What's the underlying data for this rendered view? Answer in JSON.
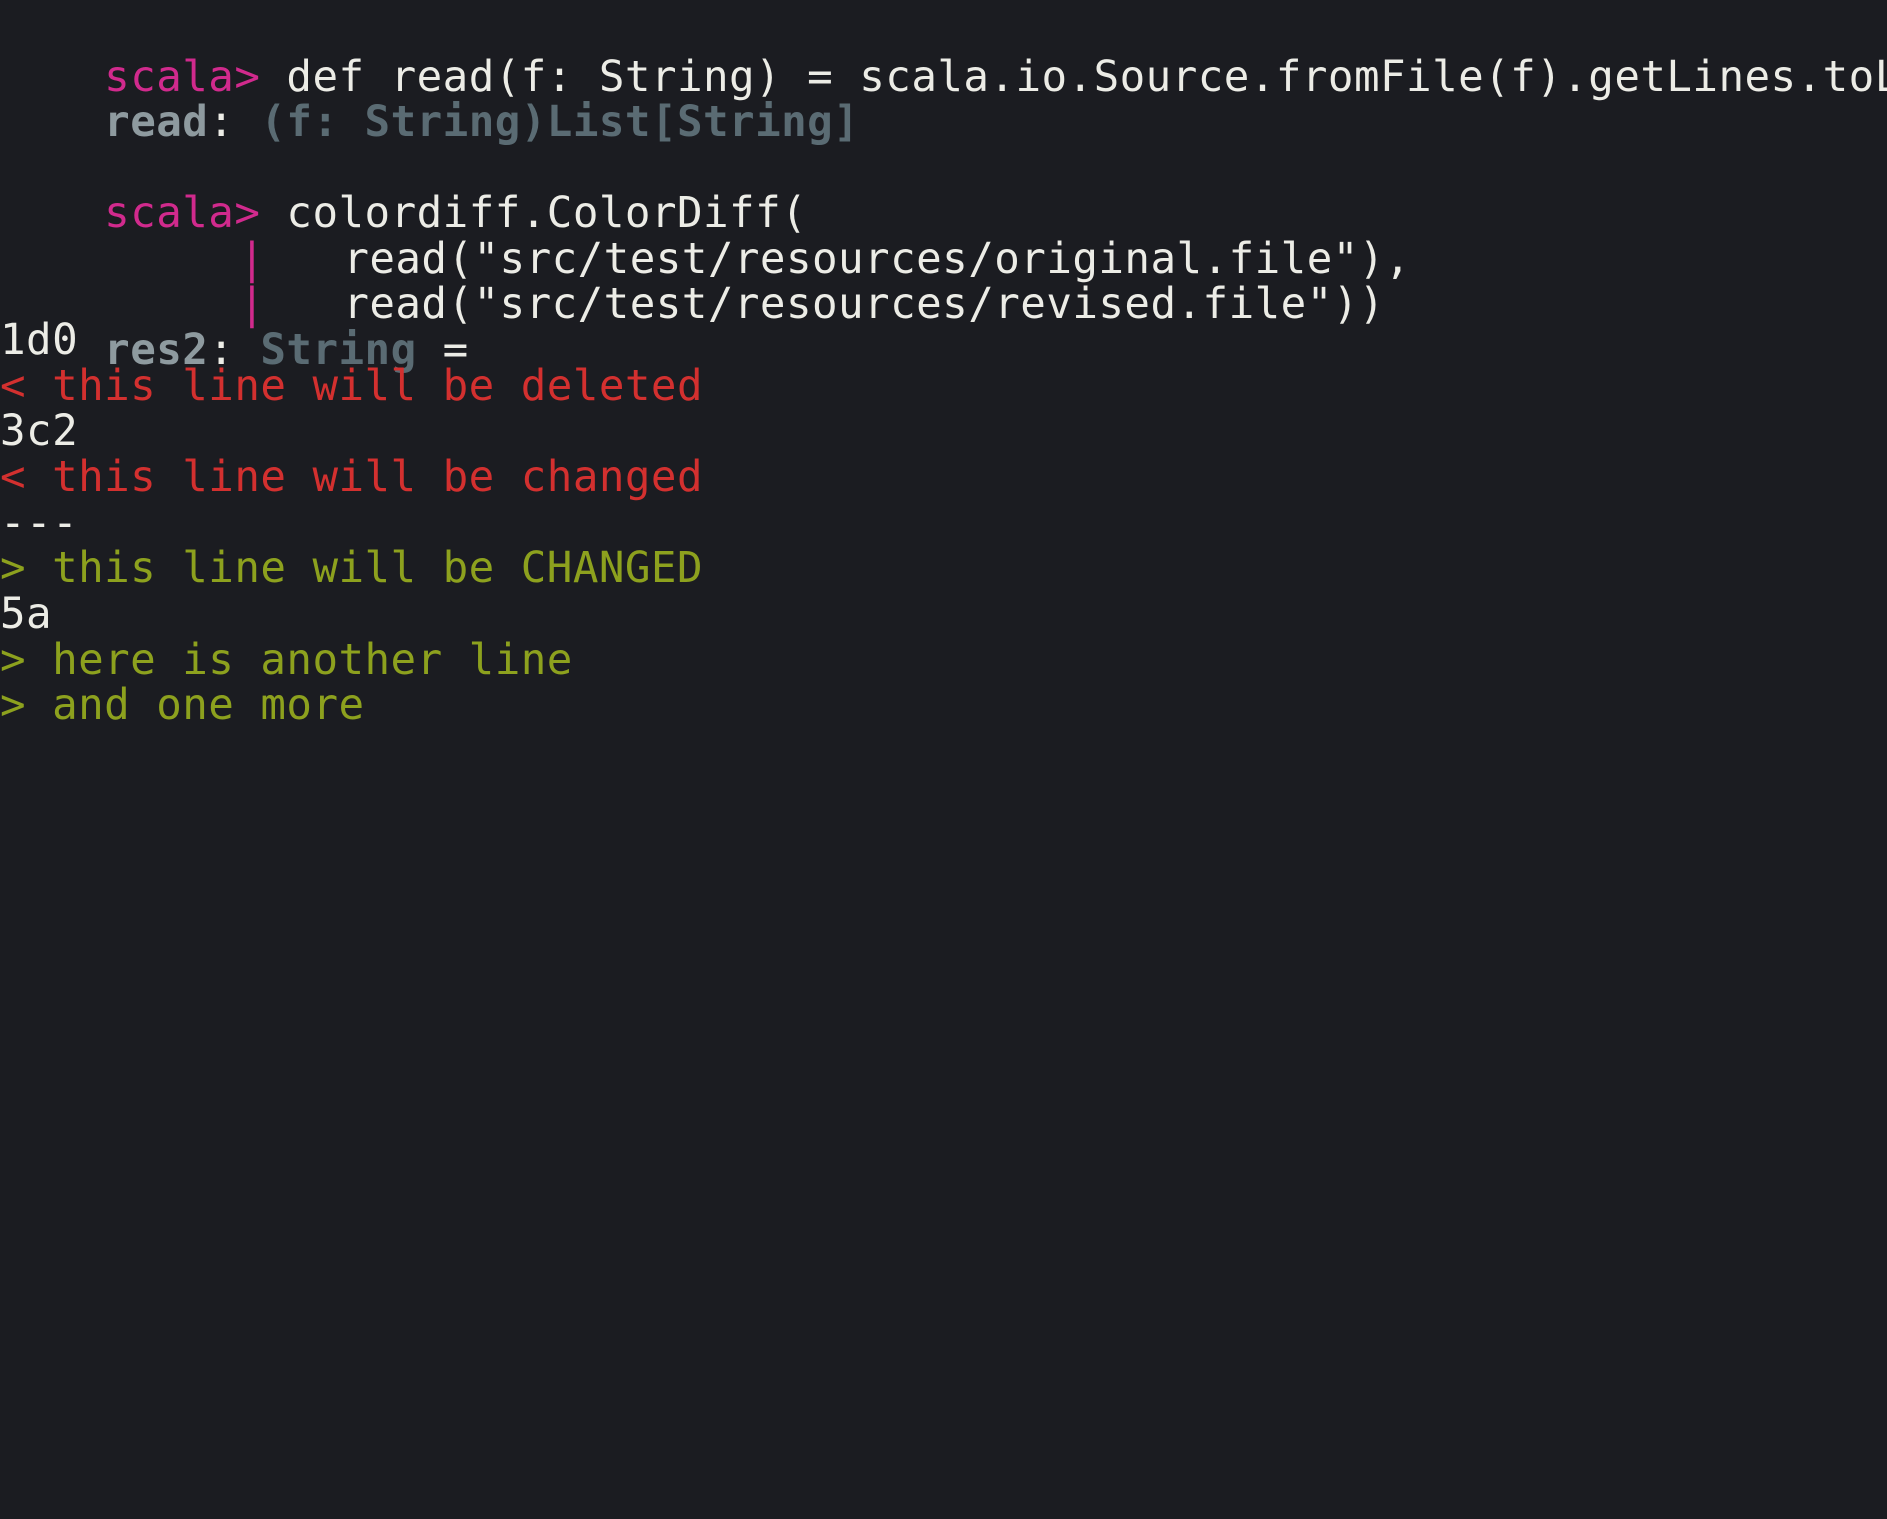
{
  "terminal": {
    "prompt": "scala>",
    "lines": {
      "l1_code": " def read(f: String) = scala.io.Source.fromFile(f).getLines.toList",
      "l2_name": "read",
      "l2_colon": ": ",
      "l2_type": "(f: String)List[String]",
      "l4_code": " colordiff.ColorDiff(",
      "l5_pipe": "|",
      "l5_code": "   read(\"src/test/resources/original.file\"),",
      "l6_pipe": "|",
      "l6_code": "   read(\"src/test/resources/revised.file\"))",
      "l7_name": "res2",
      "l7_colon": ": ",
      "l7_type": "String",
      "l7_eq": " =",
      "l8": "1d0",
      "l9": "< this line will be deleted",
      "l10": "3c2",
      "l11": "< this line will be changed",
      "l12": "---",
      "l13": "> this line will be CHANGED",
      "l14": "5a",
      "l15": "> here is another line",
      "l16": "> and one more"
    }
  },
  "colors": {
    "background": "#1b1c21",
    "prompt": "#d12a8d",
    "text": "#ecece6",
    "deleted": "#d3302f",
    "added": "#8da11e",
    "type": "#5a6b73"
  }
}
